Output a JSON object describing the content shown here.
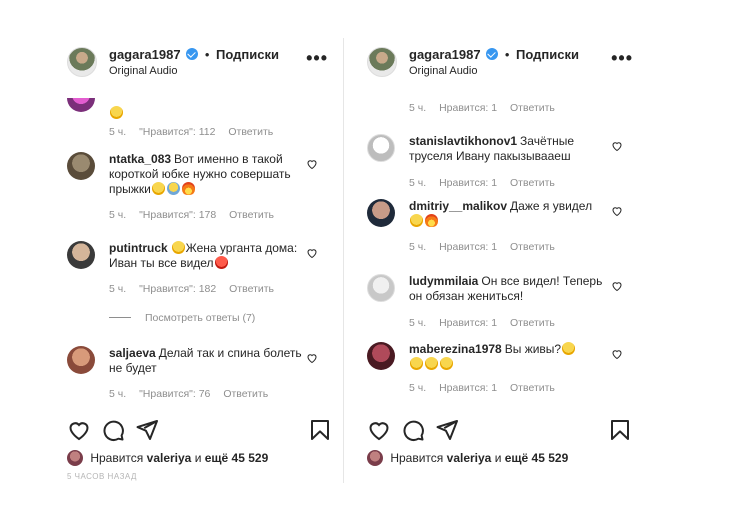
{
  "post": {
    "username": "gagara1987",
    "separator": "•",
    "follow_label": "Подписки",
    "audio_label": "Original Audio",
    "more_label": "•••"
  },
  "left": {
    "top_meta": {
      "time": "5 ч.",
      "likes": "\"Нравится\": 112",
      "reply": "Ответить"
    },
    "comments": [
      {
        "user": "ntatka_083",
        "text": "Вот именно в такой короткой юбке нужно совершать прыжки",
        "time": "5 ч.",
        "likes": "\"Нравится\": 178",
        "reply": "Ответить"
      },
      {
        "user": "putintruck",
        "text": "Жена урганта дома: Иван ты все видел",
        "time": "5 ч.",
        "likes": "\"Нравится\": 182",
        "reply": "Ответить"
      },
      {
        "user": "saljaeva",
        "text": "Делай так и спина болеть не будет",
        "time": "5 ч.",
        "likes": "\"Нравится\": 76",
        "reply": "Ответить"
      }
    ],
    "view_replies": "Посмотреть ответы (7)",
    "likes_prefix": "Нравится",
    "likes_user": "valeriya",
    "likes_mid": "и",
    "likes_more": "ещё 45 529",
    "cut_text": "5 ЧАСОВ НАЗАД"
  },
  "right": {
    "top_meta": {
      "time": "5 ч.",
      "likes": "Нравится: 1",
      "reply": "Ответить"
    },
    "comments": [
      {
        "user": "stanislavtikhonov1",
        "text": "Зачётные труселя Ивану пакызывааеш",
        "time": "5 ч.",
        "likes": "Нравится: 1",
        "reply": "Ответить"
      },
      {
        "user": "dmitriy__malikov",
        "text": "Даже я увидел",
        "time": "5 ч.",
        "likes": "Нравится: 1",
        "reply": "Ответить"
      },
      {
        "user": "ludymmilaia",
        "text": "Он все видел! Теперь он обязан жениться!",
        "time": "5 ч.",
        "likes": "Нравится: 1",
        "reply": "Ответить"
      },
      {
        "user": "maberezina1978",
        "text": "Вы живы?",
        "time": "5 ч.",
        "likes": "Нравится: 1",
        "reply": "Ответить"
      }
    ],
    "likes_prefix": "Нравится",
    "likes_user": "valeriya",
    "likes_mid": "и",
    "likes_more": "ещё 45 529"
  },
  "icons": {
    "like": "heart-icon",
    "comment": "comment-icon",
    "share": "share-icon",
    "save": "bookmark-icon",
    "verified": "verified-badge-icon",
    "more": "more-options-icon"
  },
  "colors": {
    "verified": "#3897f0",
    "muted_text": "#8e8e8e",
    "text": "#262626"
  }
}
